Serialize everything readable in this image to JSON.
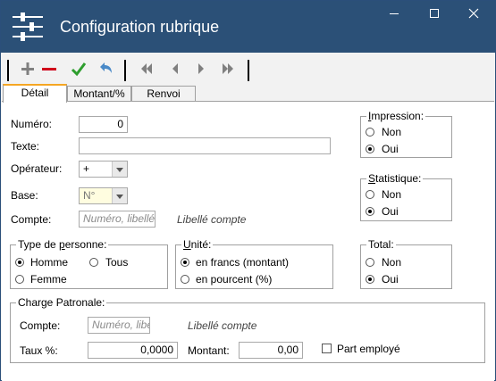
{
  "window": {
    "title": "Configuration rubrique",
    "controls": {
      "minimize": "—",
      "maximize": "☐",
      "close": "✕"
    }
  },
  "toolbar": {
    "buttons": [
      "add",
      "delete",
      "validate",
      "undo",
      "first",
      "previous",
      "next",
      "last"
    ],
    "colors": {
      "add": "#808080",
      "delete": "#d0021b",
      "validate": "#2e9e2e",
      "undo": "#4a8ac8",
      "nav": "#808080"
    }
  },
  "tabs": [
    "Détail",
    "Montant/%",
    "Renvoi"
  ],
  "active_tab": "Détail",
  "form": {
    "numero": {
      "label": "Numéro:",
      "value": "0"
    },
    "texte": {
      "label": "Texte:",
      "value": ""
    },
    "operateur": {
      "label": "Opérateur:",
      "value": "+"
    },
    "base": {
      "label": "Base:",
      "value": "N°"
    },
    "compte": {
      "label": "Compte:",
      "placeholder": "Numéro, libellé",
      "libelle": "Libellé compte"
    }
  },
  "impression": {
    "title": "Impression:",
    "options": [
      "Non",
      "Oui"
    ],
    "selected": "Oui"
  },
  "statistique": {
    "title": "Statistique:",
    "options": [
      "Non",
      "Oui"
    ],
    "selected": "Oui"
  },
  "total": {
    "title": "Total:",
    "options": [
      "Non",
      "Oui"
    ],
    "selected": "Oui"
  },
  "type_personne": {
    "title": "Type de personne:",
    "options": [
      "Homme",
      "Tous",
      "Femme"
    ],
    "selected": "Homme"
  },
  "unite": {
    "title": "Unité:",
    "options": [
      "en francs (montant)",
      "en pourcent (%)"
    ],
    "selected": "en francs (montant)"
  },
  "charge_patronale": {
    "title": "Charge Patronale:",
    "compte_label": "Compte:",
    "compte_placeholder": "Numéro, libellé",
    "compte_libelle": "Libellé compte",
    "taux_label": "Taux %:",
    "taux_value": "0,0000",
    "montant_label": "Montant:",
    "montant_value": "0,00",
    "part_employe_label": "Part employé",
    "part_employe_checked": false
  }
}
